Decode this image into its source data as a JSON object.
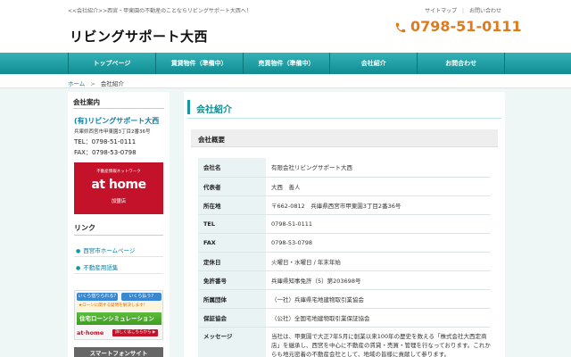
{
  "header": {
    "tagline": "<<会社紹介>>西宮・甲東園の不動産のことならリビングサポート大西へ！",
    "links": [
      "サイトマップ",
      "お問い合わせ"
    ],
    "logo": "リビングサポート大西",
    "phone": "0798-51-0111"
  },
  "nav": {
    "items": [
      "トップページ",
      "賃貸物件（準備中）",
      "売買物件（準備中）",
      "会社紹介",
      "お問合わせ"
    ]
  },
  "breadcrumb": {
    "home": "ホーム",
    "arrow": ">",
    "current": "会社紹介"
  },
  "sidebar": {
    "title": "会社案内",
    "company_name": "(有)リビングサポート大西",
    "address": "兵庫県西宮市甲東園3丁目2番36号",
    "tel": "TEL：0798-51-0111",
    "fax": "FAX：0798-53-0798",
    "athome_banner": {
      "top": "不動産情報ネットワーク",
      "logo": "at home",
      "bottom": "加盟店"
    },
    "links_title": "リンク",
    "links": [
      "西宮市ホームページ",
      "不動産用語集"
    ],
    "loan_banner": {
      "pill1": "いくら借りられる?",
      "pill2": "いくら払う?",
      "note": "★ローンに関する疑問を解決します！",
      "main": "住宅ローンシミュレーション",
      "brand": "at·home",
      "detail": "詳しくはこちらから ▶"
    },
    "smartphone": "スマートフォンサイト"
  },
  "main": {
    "title": "会社紹介",
    "section": "会社概要",
    "rows": [
      {
        "k": "会社名",
        "v": "有限会社リビングサポート大西"
      },
      {
        "k": "代表者",
        "v": "大西　善人"
      },
      {
        "k": "所在地",
        "v": "〒662-0812　兵庫県西宮市甲東園3丁目2番36号"
      },
      {
        "k": "TEL",
        "v": "0798-51-0111"
      },
      {
        "k": "FAX",
        "v": "0798-53-0798"
      },
      {
        "k": "定休日",
        "v": "火曜日・水曜日 / 年末年始"
      },
      {
        "k": "免許番号",
        "v": "兵庫県知事免許（5）第203698号"
      },
      {
        "k": "所属団体",
        "v": "（一社）兵庫県宅地建物取引業協会"
      },
      {
        "k": "保証協会",
        "v": "（公社）全国宅地建物取引業保証協会"
      },
      {
        "k": "メッセージ",
        "v": "当社は、甲東園で大正7年5月に創業以来100年の歴史を数える「株式会社大西定商店」を継承し、西宮を中心に不動産の賃貸・売買・管理を行なっております。これからも地元密着の不動産会社として、地域の皆様に貢献して参ります。"
      }
    ]
  }
}
